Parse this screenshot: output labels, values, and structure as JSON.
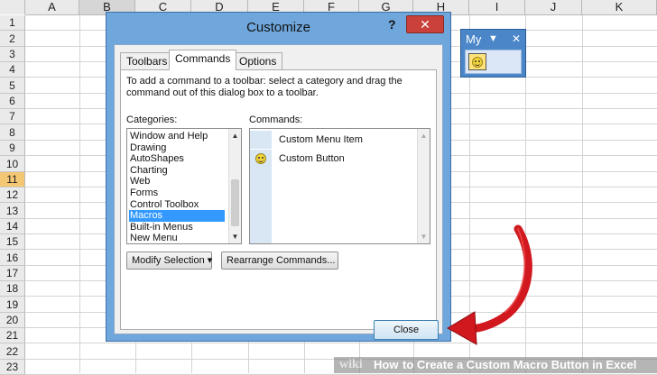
{
  "spreadsheet": {
    "columns": [
      "A",
      "B",
      "C",
      "D",
      "E",
      "F",
      "G",
      "H",
      "I",
      "J",
      "K"
    ],
    "selected_column": "B",
    "rows": [
      "1",
      "2",
      "3",
      "4",
      "5",
      "6",
      "7",
      "8",
      "9",
      "10",
      "11",
      "12",
      "13",
      "14",
      "15",
      "16",
      "17",
      "18",
      "19",
      "20",
      "21",
      "22",
      "23"
    ],
    "selected_row": "11"
  },
  "dialog": {
    "title": "Customize",
    "help_label": "?",
    "close_label": "✕",
    "tabs": [
      {
        "label": "Toolbars",
        "active": false
      },
      {
        "label": "Commands",
        "active": true
      },
      {
        "label": "Options",
        "active": false
      }
    ],
    "instructions": "To add a command to a toolbar: select a category and drag the command out of this dialog box to a toolbar.",
    "categories_label": "Categories:",
    "categories": [
      "Window and Help",
      "Drawing",
      "AutoShapes",
      "Charting",
      "Web",
      "Forms",
      "Control Toolbox",
      "Macros",
      "Built-in Menus",
      "New Menu"
    ],
    "selected_category": "Macros",
    "commands_label": "Commands:",
    "commands": [
      {
        "label": "Custom Menu Item",
        "icon": ""
      },
      {
        "label": "Custom Button",
        "icon": "smiley-icon"
      }
    ],
    "modify_selection_label": "Modify Selection ▾",
    "rearrange_label": "Rearrange Commands...",
    "close_button_label": "Close"
  },
  "custom_toolbar": {
    "title": "My",
    "dropdown_glyph": "▼",
    "close_glyph": "✕",
    "button_icon": "smiley-icon"
  },
  "watermark": {
    "brand": "wiki",
    "how": "How",
    "title": " to Create a Custom Macro Button in Excel"
  },
  "colors": {
    "dialog_frame": "#6fa7dc",
    "close_button": "#c9413a",
    "selection": "#3399ff",
    "arrow": "#d0181e"
  }
}
